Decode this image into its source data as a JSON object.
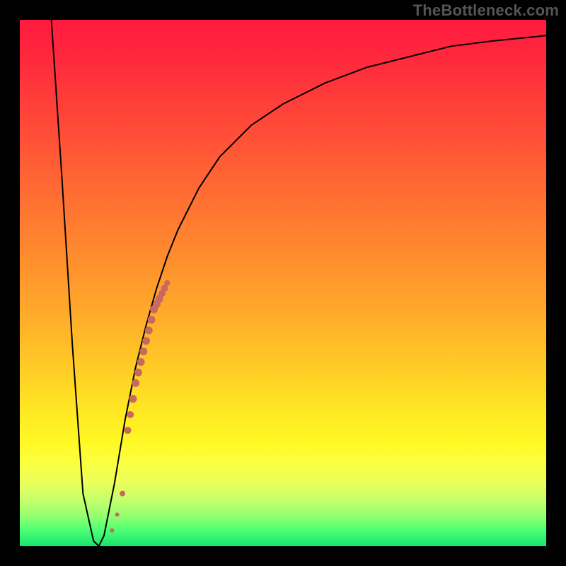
{
  "watermark": "TheBottleneck.com",
  "colors": {
    "curve": "#000000",
    "points": "#c9685f",
    "background_black": "#000000"
  },
  "chart_data": {
    "type": "line",
    "title": "",
    "xlabel": "",
    "ylabel": "",
    "xlim": [
      0,
      100
    ],
    "ylim": [
      0,
      100
    ],
    "grid": false,
    "legend": false,
    "series": [
      {
        "name": "curve",
        "stroke": "#000000",
        "x": [
          6,
          8,
          10,
          12,
          14,
          15,
          16,
          18,
          20,
          22,
          24,
          26,
          28,
          30,
          34,
          38,
          44,
          50,
          58,
          66,
          74,
          82,
          90,
          100
        ],
        "y": [
          100,
          70,
          38,
          10,
          1,
          0,
          2,
          12,
          24,
          34,
          42,
          49,
          55,
          60,
          68,
          74,
          80,
          84,
          88,
          91,
          93,
          95,
          96,
          97
        ]
      }
    ],
    "points": {
      "name": "highlighted-segment",
      "fill": "#c9685f",
      "x": [
        17.5,
        18.5,
        19.5,
        20.5,
        21.0,
        21.5,
        22.0,
        22.5,
        23.0,
        23.5,
        24.0,
        24.5,
        25.0,
        25.5,
        26.0,
        26.5,
        27.0,
        27.5,
        28.0
      ],
      "y": [
        3,
        6,
        10,
        22,
        25,
        28,
        31,
        33,
        35,
        37,
        39,
        41,
        43,
        45,
        46,
        47,
        48,
        49,
        50
      ],
      "r": [
        3,
        3,
        4,
        5,
        5,
        5.5,
        5.5,
        5.5,
        5.5,
        5.5,
        5.5,
        5.5,
        5.5,
        5.5,
        5.5,
        5.5,
        5,
        5,
        4
      ]
    }
  }
}
